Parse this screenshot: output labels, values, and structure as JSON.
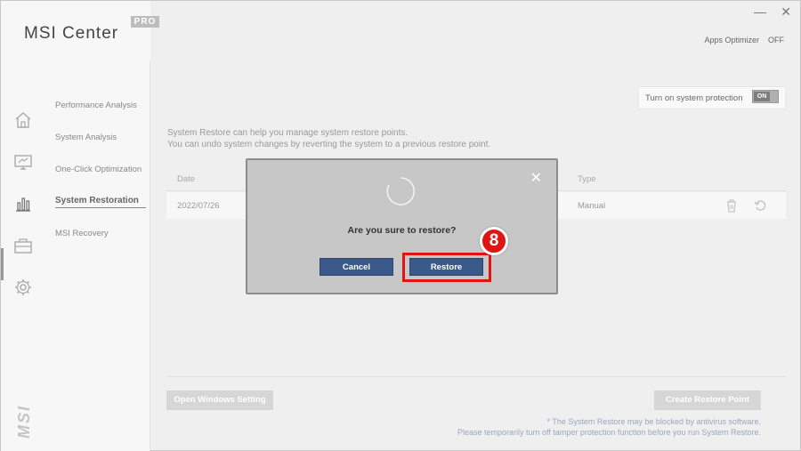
{
  "app": {
    "title": "MSI Center",
    "edition": "PRO"
  },
  "window_controls": {
    "minimize": "—",
    "close": "✕"
  },
  "header": {
    "apps_optimizer_label": "Apps Optimizer",
    "apps_optimizer_state": "OFF"
  },
  "rail": {
    "icons": [
      "home-icon",
      "monitor-icon",
      "chart-bars-icon",
      "toolbox-icon",
      "gear-icon"
    ],
    "active": "chart-bars-icon",
    "logo": "MSI"
  },
  "submenu": {
    "items": [
      {
        "label": "Performance Analysis"
      },
      {
        "label": "System Analysis"
      },
      {
        "label": "One-Click Optimization"
      },
      {
        "label": "System Restoration"
      },
      {
        "label": "MSI Recovery"
      }
    ],
    "active_index": 3
  },
  "main": {
    "toggle_label": "Turn on system protection",
    "toggle_state": "ON",
    "description_line1": "System Restore can help you manage system restore points.",
    "description_line2": "You can undo system changes by reverting the system to a previous restore point.",
    "table": {
      "headers": [
        "Date",
        "Type"
      ],
      "rows": [
        {
          "date": "2022/07/26",
          "type": "Manual"
        }
      ]
    },
    "open_windows_setting": "Open Windows Setting",
    "create_restore_point": "Create Restore Point",
    "note_line1": "* The System Restore may be blocked by antivirus software.",
    "note_line2": "Please temporarily turn off tamper protection function before you run System Restore."
  },
  "modal": {
    "close": "✕",
    "question": "Are you sure to restore?",
    "cancel_label": "Cancel",
    "restore_label": "Restore"
  },
  "annotation": {
    "step_number": "8",
    "highlight_color": "#e11414"
  },
  "colors": {
    "modal_button": "#3b5a8a",
    "note_text": "#9aa6bf"
  }
}
